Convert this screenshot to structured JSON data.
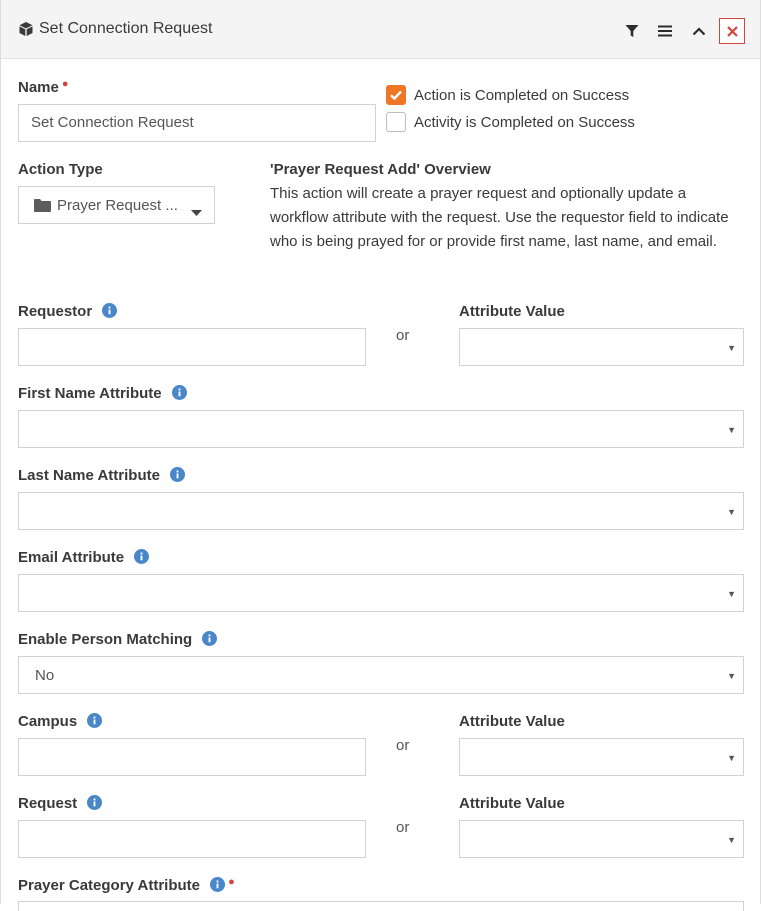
{
  "header": {
    "title": "Set Connection Request",
    "icons": [
      "cube-icon",
      "filter-icon",
      "menu-icon",
      "chevron-up-icon",
      "close-icon"
    ]
  },
  "colors": {
    "accent": "#ee7624",
    "required": "#d3443c",
    "info": "#4a87c9"
  },
  "name_field": {
    "label": "Name",
    "value": "Set Connection Request"
  },
  "checkboxes": [
    {
      "label": "Action is Completed on Success",
      "checked": true
    },
    {
      "label": "Activity is Completed on Success",
      "checked": false
    }
  ],
  "action_type": {
    "label": "Action Type",
    "value": "Prayer Request ..."
  },
  "overview": {
    "title": "'Prayer Request Add' Overview",
    "text": "This action will create a prayer request and optionally update a workflow attribute with the request. Use the requestor field to indicate who is being prayed for or provide first name, last name, and email."
  },
  "or_text": "or",
  "requestor": {
    "label": "Requestor",
    "value": "",
    "alt_label": "Attribute Value",
    "alt_value": ""
  },
  "first_name": {
    "label": "First Name Attribute",
    "value": ""
  },
  "last_name": {
    "label": "Last Name Attribute",
    "value": ""
  },
  "email": {
    "label": "Email Attribute",
    "value": ""
  },
  "person_matching": {
    "label": "Enable Person Matching",
    "value": "No"
  },
  "campus": {
    "label": "Campus",
    "value": "",
    "alt_label": "Attribute Value",
    "alt_value": ""
  },
  "request": {
    "label": "Request",
    "value": "",
    "alt_label": "Attribute Value",
    "alt_value": ""
  },
  "prayer_category": {
    "label": "Prayer Category Attribute"
  }
}
